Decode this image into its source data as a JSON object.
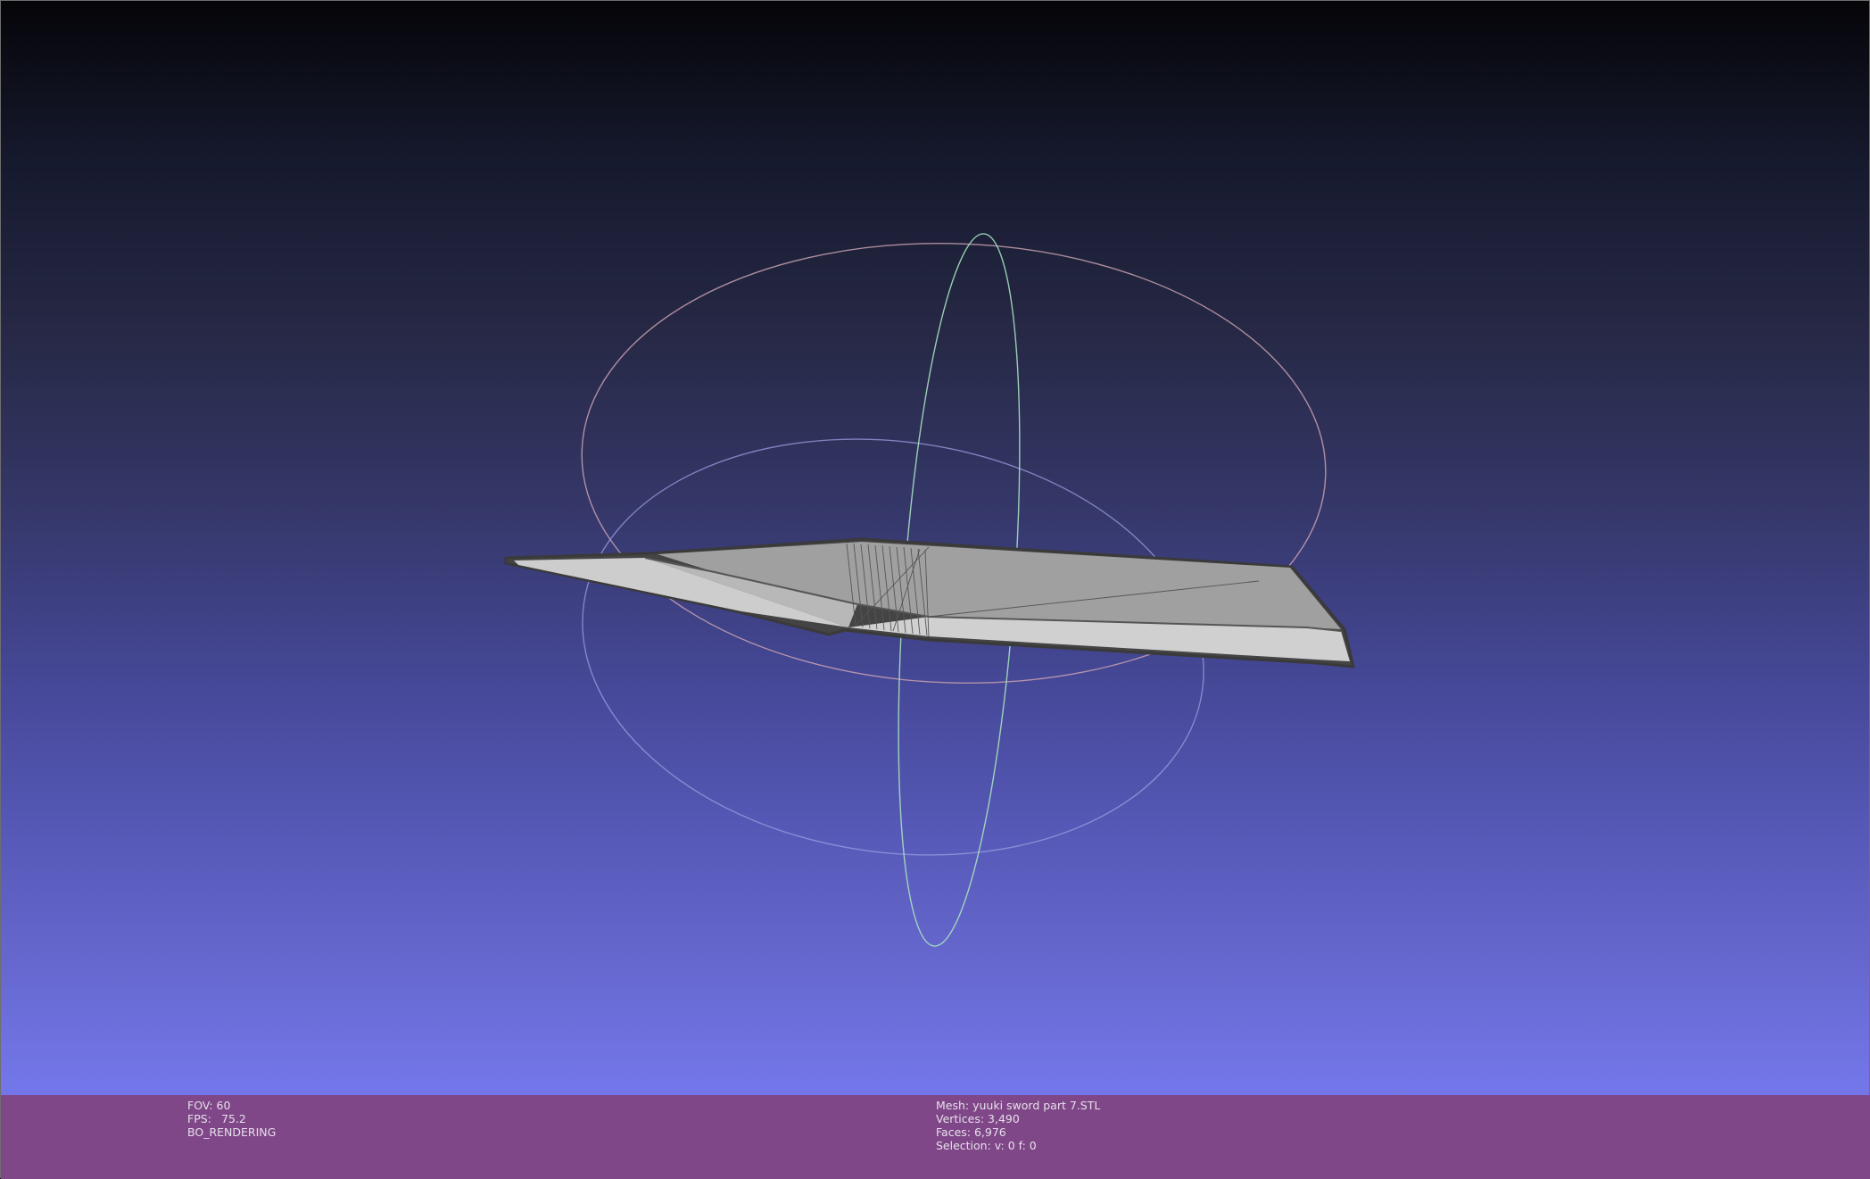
{
  "viewer": {
    "colors": {
      "background_top": "#050509",
      "background_bottom": "#7778ec",
      "info_bar": "#7f4787",
      "mesh_face_light": "#c8c8c8",
      "mesh_face_dark": "#999999",
      "mesh_outline": "#3a3a3a",
      "trackball_red": "#c79aa8",
      "trackball_green": "#9ad8b4",
      "trackball_blue": "#8f8fd8"
    },
    "trackball": {
      "icon": "trackball-gizmo-icon"
    },
    "mesh": {
      "icon": "sword-blade-mesh"
    }
  },
  "status_left": {
    "fov": "FOV: 60",
    "fps_label": "FPS:",
    "fps_value": "75.2",
    "mode": "BO_RENDERING"
  },
  "status_right": {
    "mesh": "Mesh: yuuki sword part 7.STL",
    "vertices": "Vertices: 3,490",
    "faces": "Faces: 6,976",
    "selection": "Selection: v: 0 f: 0"
  }
}
